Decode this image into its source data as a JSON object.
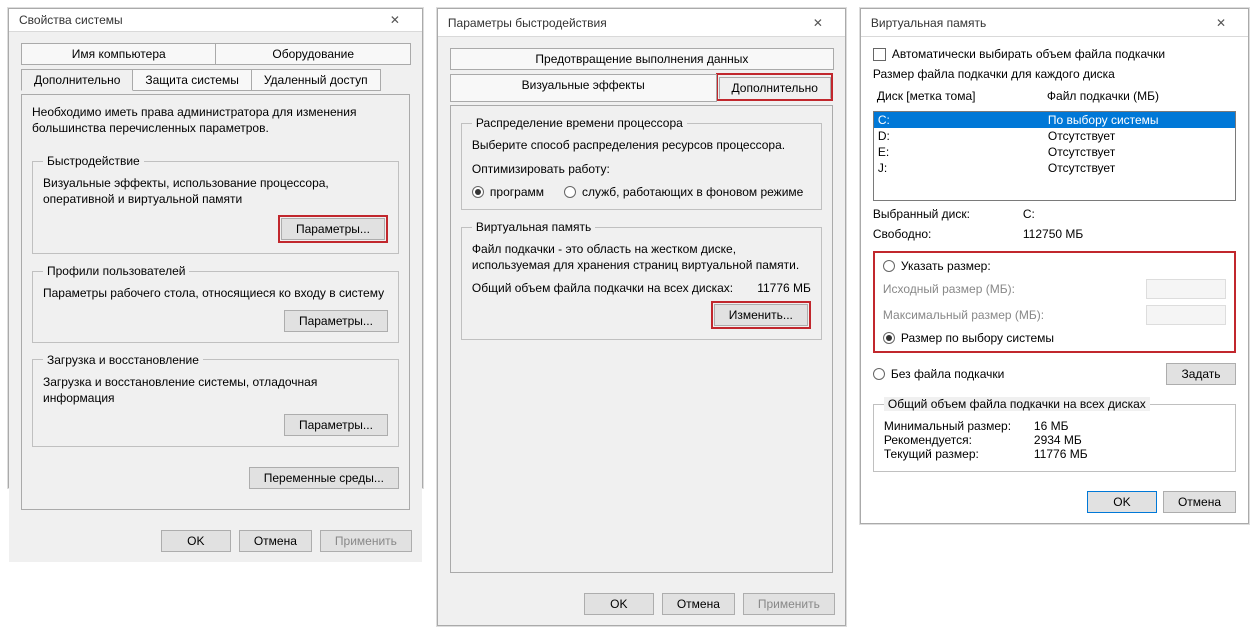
{
  "winA": {
    "title": "Свойства системы",
    "tabs_row1": [
      "Имя компьютера",
      "Оборудование"
    ],
    "tabs_row2": [
      "Дополнительно",
      "Защита системы",
      "Удаленный доступ"
    ],
    "intro": "Необходимо иметь права администратора для изменения большинства перечисленных параметров.",
    "perf_legend": "Быстродействие",
    "perf_desc": "Визуальные эффекты, использование процессора, оперативной и виртуальной памяти",
    "params_btn": "Параметры...",
    "prof_legend": "Профили пользователей",
    "prof_desc": "Параметры рабочего стола, относящиеся ко входу в систему",
    "boot_legend": "Загрузка и восстановление",
    "boot_desc": "Загрузка и восстановление системы, отладочная информация",
    "env_btn": "Переменные среды...",
    "ok": "OK",
    "cancel": "Отмена",
    "apply": "Применить"
  },
  "winB": {
    "title": "Параметры быстродействия",
    "tabs_row1": [
      "Предотвращение выполнения данных"
    ],
    "tabs_row2": [
      "Визуальные эффекты",
      "Дополнительно"
    ],
    "cpu_legend": "Распределение времени процессора",
    "cpu_desc": "Выберите способ распределения ресурсов процессора.",
    "opt_label": "Оптимизировать работу:",
    "radio_programs": "программ",
    "radio_services": "служб, работающих в фоновом режиме",
    "vm_legend": "Виртуальная память",
    "vm_desc": "Файл подкачки - это область на жестком диске, используемая для хранения страниц виртуальной памяти.",
    "vm_total_label": "Общий объем файла подкачки на всех дисках:",
    "vm_total_value": "11776 МБ",
    "change_btn": "Изменить...",
    "ok": "OK",
    "cancel": "Отмена",
    "apply": "Применить"
  },
  "winC": {
    "title": "Виртуальная память",
    "auto_check": "Автоматически выбирать объем файла подкачки",
    "per_drive_label": "Размер файла подкачки для каждого диска",
    "hdr_disk": "Диск [метка тома]",
    "hdr_pf": "Файл подкачки (МБ)",
    "rows": [
      {
        "d": "C:",
        "v": "По выбору системы"
      },
      {
        "d": "D:",
        "v": "Отсутствует"
      },
      {
        "d": "E:",
        "v": "Отсутствует"
      },
      {
        "d": "J:",
        "v": "Отсутствует"
      }
    ],
    "sel_drive_label": "Выбранный диск:",
    "sel_drive_value": "C:",
    "free_label": "Свободно:",
    "free_value": "112750 МБ",
    "radio_custom": "Указать размер:",
    "initial_label": "Исходный размер (МБ):",
    "max_label": "Максимальный размер (МБ):",
    "radio_system": "Размер по выбору системы",
    "radio_none": "Без файла подкачки",
    "set_btn": "Задать",
    "total_legend": "Общий объем файла подкачки на всех дисках",
    "min_label": "Минимальный размер:",
    "min_value": "16 МБ",
    "rec_label": "Рекомендуется:",
    "rec_value": "2934 МБ",
    "cur_label": "Текущий размер:",
    "cur_value": "11776 МБ",
    "ok": "OK",
    "cancel": "Отмена"
  }
}
